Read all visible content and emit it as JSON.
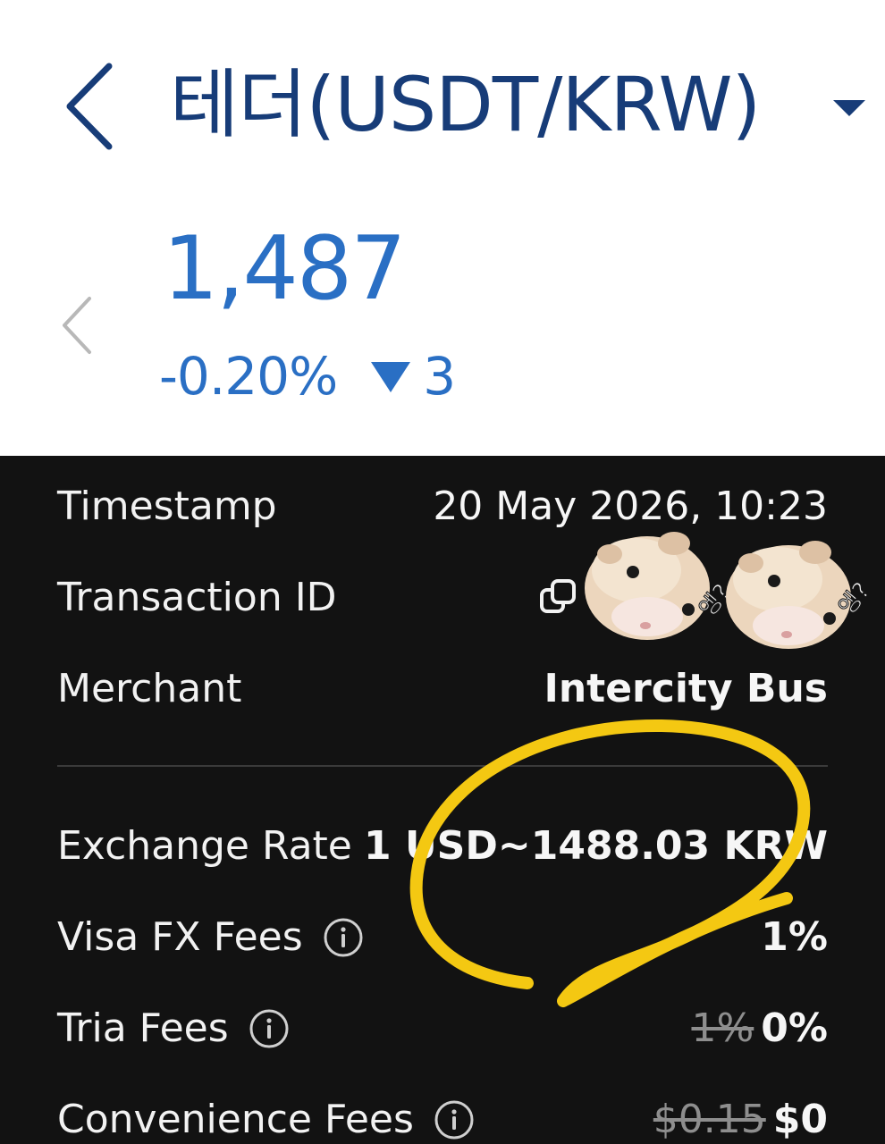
{
  "header": {
    "title": "테더(USDT/KRW)",
    "back_icon": "chevron-left-icon",
    "dropdown_icon": "caret-down-icon"
  },
  "price": {
    "value": "1,487",
    "change_percent": "-0.20%",
    "change_amount": "3",
    "change_icon": "triangle-down-icon",
    "prev_icon": "chevron-left-icon"
  },
  "details": {
    "timestamp": {
      "label": "Timestamp",
      "value": "20 May 2026, 10:23"
    },
    "transaction_id": {
      "label": "Transaction ID",
      "copy_icon": "copy-icon"
    },
    "merchant": {
      "label": "Merchant",
      "value": "Intercity Bus"
    },
    "exchange_rate": {
      "label": "Exchange Rate",
      "value": "1 USD~1488.03 KRW"
    },
    "visa_fx_fees": {
      "label": "Visa FX Fees",
      "value": "1%"
    },
    "tria_fees": {
      "label": "Tria Fees",
      "old_value": "1%",
      "value": "0%"
    },
    "convenience_fees": {
      "label": "Convenience Fees",
      "old_value": "$0.15",
      "value": "$0"
    }
  },
  "stickers": [
    {
      "text": "엥?"
    },
    {
      "text": "엥?"
    }
  ],
  "colors": {
    "title": "#173c78",
    "price_blue": "#2a6fc4",
    "panel_bg": "#121212",
    "annotation_yellow": "#f4c812"
  }
}
